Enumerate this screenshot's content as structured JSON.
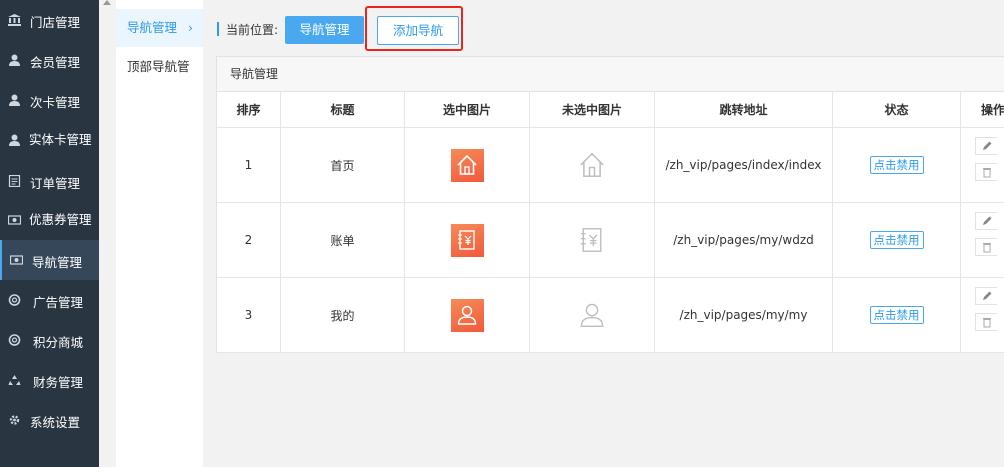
{
  "sidebar": {
    "items": [
      {
        "label": "门店管理",
        "icon": "bank-icon"
      },
      {
        "label": "会员管理",
        "icon": "user-icon"
      },
      {
        "label": "次卡管理",
        "icon": "user-icon"
      },
      {
        "label": "实体卡管理",
        "icon": "user-icon"
      },
      {
        "label": "订单管理",
        "icon": "document-icon"
      },
      {
        "label": "优惠券管理",
        "icon": "money-icon"
      },
      {
        "label": "导航管理",
        "icon": "money-icon"
      },
      {
        "label": "广告管理",
        "icon": "life-ring-icon"
      },
      {
        "label": "积分商城",
        "icon": "life-ring-icon"
      },
      {
        "label": "财务管理",
        "icon": "recycle-icon"
      },
      {
        "label": "系统设置",
        "icon": "gear-icon"
      }
    ]
  },
  "subnav": {
    "items": [
      {
        "label": "导航管理"
      },
      {
        "label": "顶部导航管"
      }
    ]
  },
  "breadcrumb": {
    "label": "当前位置:",
    "current": "导航管理",
    "add_button": "添加导航"
  },
  "panel": {
    "title": "导航管理",
    "columns": [
      "排序",
      "标题",
      "选中图片",
      "未选中图片",
      "跳转地址",
      "状态",
      "操作"
    ],
    "rows": [
      {
        "order": "1",
        "title": "首页",
        "icon": "house-icon",
        "url": "/zh_vip/pages/index/index",
        "status": "点击禁用"
      },
      {
        "order": "2",
        "title": "账单",
        "icon": "bill-icon",
        "url": "/zh_vip/pages/my/wdzd",
        "status": "点击禁用"
      },
      {
        "order": "3",
        "title": "我的",
        "icon": "person-icon",
        "url": "/zh_vip/pages/my/my",
        "status": "点击禁用"
      }
    ]
  },
  "colors": {
    "sidebar_bg": "#2a3542",
    "accent": "#4aa8f0",
    "highlight": "#e8261b",
    "icon_selected": "#f26b47"
  }
}
